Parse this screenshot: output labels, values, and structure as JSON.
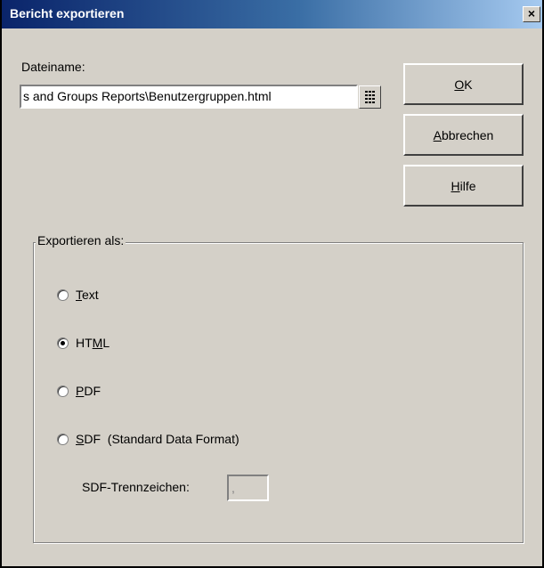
{
  "dialog": {
    "title": "Bericht exportieren",
    "close_glyph": "×"
  },
  "filename": {
    "label": "Dateiname:",
    "value": "s and Groups Reports\\Benutzergruppen.html",
    "browse_icon": "browse-icon"
  },
  "buttons": {
    "ok": {
      "pre": "",
      "mnemonic": "O",
      "post": "K"
    },
    "cancel": {
      "pre": "",
      "mnemonic": "A",
      "post": "bbrechen"
    },
    "help": {
      "pre": "",
      "mnemonic": "H",
      "post": "ilfe"
    }
  },
  "export_group": {
    "legend": "Exportieren als:",
    "selected": "HTML",
    "options": [
      {
        "pre": "",
        "mnemonic": "T",
        "post": "ext",
        "checked": false
      },
      {
        "pre": "HT",
        "mnemonic": "M",
        "post": "L",
        "checked": true
      },
      {
        "pre": "",
        "mnemonic": "P",
        "post": "DF",
        "checked": false
      },
      {
        "pre": "",
        "mnemonic": "S",
        "post": "DF  (Standard Data Format)",
        "checked": false
      }
    ],
    "delimiter_label": "SDF-Trennzeichen:",
    "delimiter_value": ","
  }
}
